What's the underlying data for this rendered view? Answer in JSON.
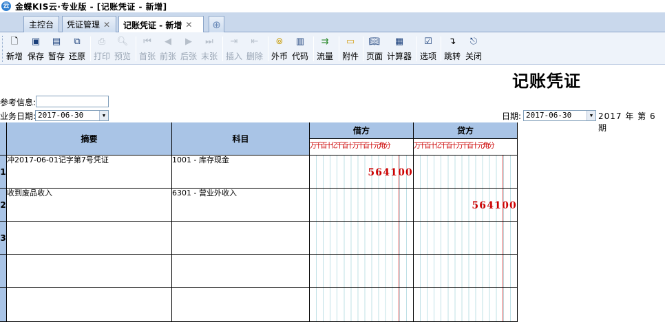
{
  "app": {
    "title": "金蝶KIS云·专业版 - [记账凭证 - 新增]",
    "logo_text": "云"
  },
  "tabs": [
    {
      "label": "主控台"
    },
    {
      "label": "凭证管理"
    },
    {
      "label": "记账凭证 - 新增"
    }
  ],
  "toolbar": {
    "new": "新增",
    "save": "保存",
    "draft": "暂存",
    "restore": "还原",
    "print": "打印",
    "preview": "预览",
    "first": "首张",
    "prev": "前张",
    "next": "后张",
    "last": "末张",
    "insert": "插入",
    "delete": "删除",
    "currency": "外币",
    "code": "代码",
    "cashflow": "流量",
    "attachment": "附件",
    "page": "页面",
    "calculator": "计算器",
    "options": "选项",
    "jump": "跳转",
    "close": "关闭"
  },
  "voucher": {
    "title": "记账凭证",
    "ref_label": "参考信息:",
    "ref_value": "",
    "biz_date_label": "业务日期:",
    "biz_date": "2017-06-30",
    "date_label": "日期:",
    "date": "2017-06-30",
    "period_text": "2017 年 第 6 期"
  },
  "grid": {
    "col_summary": "摘要",
    "col_account": "科目",
    "col_debit": "借方",
    "col_credit": "贷方",
    "units": "万千百十亿千百十万千百十元角分",
    "rows": [
      {
        "num": "1",
        "summary": "冲2017-06-01记字第7号凭证",
        "account": "1001 - 库存现金",
        "debit": "564100",
        "credit": ""
      },
      {
        "num": "2",
        "summary": "收到废品收入",
        "account": "6301 - 营业外收入",
        "debit": "",
        "credit": "564100"
      },
      {
        "num": "3",
        "summary": "",
        "account": "",
        "debit": "",
        "credit": ""
      },
      {
        "num": "",
        "summary": "",
        "account": "",
        "debit": "",
        "credit": ""
      },
      {
        "num": "",
        "summary": "",
        "account": "",
        "debit": "",
        "credit": ""
      }
    ]
  }
}
